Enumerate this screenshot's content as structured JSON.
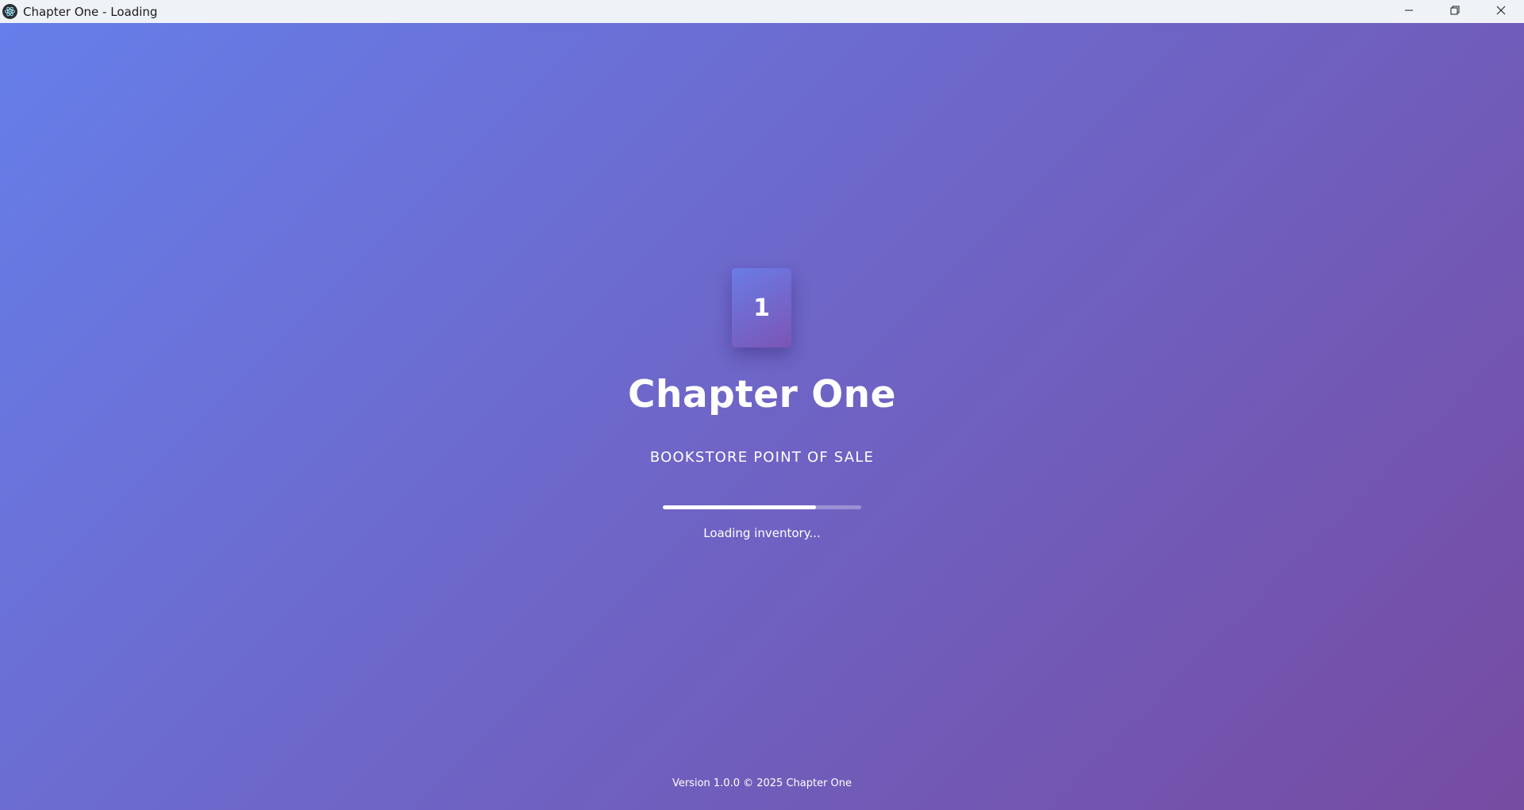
{
  "window": {
    "title": "Chapter One - Loading",
    "app_icon": "electron-atom-icon",
    "controls": [
      "minimize-icon",
      "restore-icon",
      "close-icon"
    ]
  },
  "splash": {
    "logo_text": "1",
    "app_name": "Chapter One",
    "subtitle": "BOOKSTORE POINT OF SALE",
    "progress_fraction": 0.77,
    "status": "Loading inventory...",
    "version": "Version 1.0.0 © 2025 Chapter One"
  },
  "colors": {
    "gradient_start": "#667eea",
    "gradient_end": "#764ba2",
    "titlebar_bg": "#eff3f8",
    "text": "#ffffff"
  }
}
